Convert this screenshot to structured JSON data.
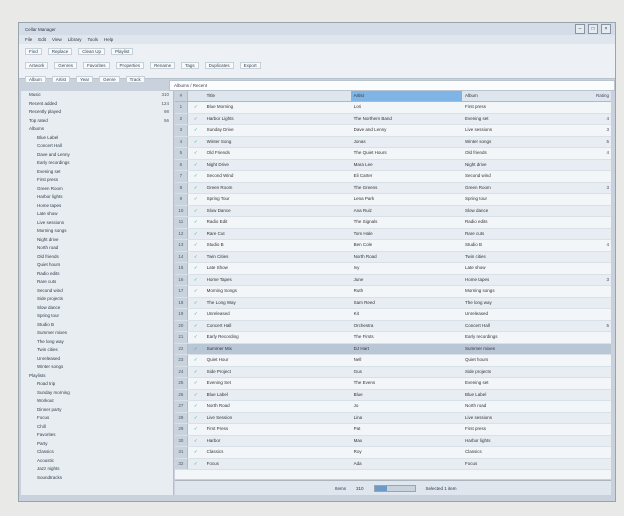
{
  "window": {
    "title": "Cellar Manager"
  },
  "menu": [
    "File",
    "Edit",
    "View",
    "Library",
    "Tools",
    "Help"
  ],
  "ribbon": {
    "row1": [
      "Find",
      "Replace",
      "Clean Up",
      "Playlist"
    ],
    "row2": [
      "Artwork",
      "Genres",
      "Favorites",
      "Properties",
      "Rename",
      "Tags",
      "Duplicates",
      "Export"
    ],
    "row3": [
      "Album",
      "Artist",
      "Year",
      "Genre",
      "Track"
    ]
  },
  "address": "Albums / Recent",
  "tree": [
    {
      "label": "Music",
      "count": "310"
    },
    {
      "label": "Recent added",
      "count": "124"
    },
    {
      "label": "Recently played",
      "count": "98"
    },
    {
      "label": "Top rated",
      "count": "56"
    },
    {
      "label": "Albums",
      "count": ""
    },
    {
      "label": "Blue Label",
      "count": ""
    },
    {
      "label": "Concert Hall",
      "count": ""
    },
    {
      "label": "Dave and Lenny",
      "count": ""
    },
    {
      "label": "Early recordings",
      "count": ""
    },
    {
      "label": "Evening set",
      "count": ""
    },
    {
      "label": "First press",
      "count": ""
    },
    {
      "label": "Green Room",
      "count": ""
    },
    {
      "label": "Harbor lights",
      "count": ""
    },
    {
      "label": "Home tapes",
      "count": ""
    },
    {
      "label": "Late show",
      "count": ""
    },
    {
      "label": "Live sessions",
      "count": ""
    },
    {
      "label": "Morning songs",
      "count": ""
    },
    {
      "label": "Night drive",
      "count": ""
    },
    {
      "label": "North road",
      "count": ""
    },
    {
      "label": "Old friends",
      "count": ""
    },
    {
      "label": "Quiet hours",
      "count": ""
    },
    {
      "label": "Radio edits",
      "count": ""
    },
    {
      "label": "Rare cuts",
      "count": ""
    },
    {
      "label": "Second wind",
      "count": ""
    },
    {
      "label": "Side projects",
      "count": ""
    },
    {
      "label": "Slow dance",
      "count": ""
    },
    {
      "label": "Spring tour",
      "count": ""
    },
    {
      "label": "Studio B",
      "count": ""
    },
    {
      "label": "Summer mixes",
      "count": ""
    },
    {
      "label": "The long way",
      "count": ""
    },
    {
      "label": "Twin cities",
      "count": ""
    },
    {
      "label": "Unreleased",
      "count": ""
    },
    {
      "label": "Winter songs",
      "count": ""
    },
    {
      "label": "Playlists",
      "count": ""
    },
    {
      "label": "Road trip",
      "count": ""
    },
    {
      "label": "Sunday morning",
      "count": ""
    },
    {
      "label": "Workout",
      "count": ""
    },
    {
      "label": "Dinner party",
      "count": ""
    },
    {
      "label": "Focus",
      "count": ""
    },
    {
      "label": "Chill",
      "count": ""
    },
    {
      "label": "Favorites",
      "count": ""
    },
    {
      "label": "Party",
      "count": ""
    },
    {
      "label": "Classics",
      "count": ""
    },
    {
      "label": "Acoustic",
      "count": ""
    },
    {
      "label": "Jazz nights",
      "count": ""
    },
    {
      "label": "Soundtracks",
      "count": ""
    }
  ],
  "columns": {
    "num": "#",
    "title": "Title",
    "artist": "Artist",
    "album": "Album",
    "rating": "Rating"
  },
  "rows": [
    {
      "n": "1",
      "title": "Blue Morning",
      "artist": "Lori",
      "album": "First press",
      "rating": ""
    },
    {
      "n": "2",
      "title": "Harbor Lights",
      "artist": "The Northern Band",
      "album": "Evening set",
      "rating": "4"
    },
    {
      "n": "3",
      "title": "Sunday Drive",
      "artist": "Dave and Lenny",
      "album": "Live sessions",
      "rating": "3"
    },
    {
      "n": "4",
      "title": "Winter Song",
      "artist": "Jonas",
      "album": "Winter songs",
      "rating": "5"
    },
    {
      "n": "5",
      "title": "Old Friends",
      "artist": "The Quiet Hours",
      "album": "Old friends",
      "rating": "4"
    },
    {
      "n": "6",
      "title": "Night Drive",
      "artist": "Mara Lee",
      "album": "Night drive",
      "rating": ""
    },
    {
      "n": "7",
      "title": "Second Wind",
      "artist": "Eli Carter",
      "album": "Second wind",
      "rating": ""
    },
    {
      "n": "8",
      "title": "Green Room",
      "artist": "The Greens",
      "album": "Green Room",
      "rating": "3"
    },
    {
      "n": "9",
      "title": "Spring Tour",
      "artist": "Lena Park",
      "album": "Spring tour",
      "rating": ""
    },
    {
      "n": "10",
      "title": "Slow Dance",
      "artist": "Ana Ruiz",
      "album": "Slow dance",
      "rating": ""
    },
    {
      "n": "11",
      "title": "Radio Edit",
      "artist": "The Signals",
      "album": "Radio edits",
      "rating": ""
    },
    {
      "n": "12",
      "title": "Rare Cut",
      "artist": "Tom Hale",
      "album": "Rare cuts",
      "rating": ""
    },
    {
      "n": "13",
      "title": "Studio B",
      "artist": "Ben Cole",
      "album": "Studio B",
      "rating": "4"
    },
    {
      "n": "14",
      "title": "Twin Cities",
      "artist": "North Road",
      "album": "Twin cities",
      "rating": ""
    },
    {
      "n": "15",
      "title": "Late Show",
      "artist": "Ivy",
      "album": "Late show",
      "rating": ""
    },
    {
      "n": "16",
      "title": "Home Tapes",
      "artist": "June",
      "album": "Home tapes",
      "rating": "3"
    },
    {
      "n": "17",
      "title": "Morning Songs",
      "artist": "Ruth",
      "album": "Morning songs",
      "rating": ""
    },
    {
      "n": "18",
      "title": "The Long Way",
      "artist": "Sam Reed",
      "album": "The long way",
      "rating": ""
    },
    {
      "n": "19",
      "title": "Unreleased",
      "artist": "Kit",
      "album": "Unreleased",
      "rating": ""
    },
    {
      "n": "20",
      "title": "Concert Hall",
      "artist": "Orchestra",
      "album": "Concert Hall",
      "rating": "5"
    },
    {
      "n": "21",
      "title": "Early Recording",
      "artist": "The Firsts",
      "album": "Early recordings",
      "rating": ""
    },
    {
      "n": "22",
      "title": "Summer Mix",
      "artist": "DJ Hart",
      "album": "Summer mixes",
      "rating": ""
    },
    {
      "n": "23",
      "title": "Quiet Hour",
      "artist": "Nell",
      "album": "Quiet hours",
      "rating": ""
    },
    {
      "n": "24",
      "title": "Side Project",
      "artist": "Gus",
      "album": "Side projects",
      "rating": ""
    },
    {
      "n": "25",
      "title": "Evening Set",
      "artist": "The Evens",
      "album": "Evening set",
      "rating": ""
    },
    {
      "n": "26",
      "title": "Blue Label",
      "artist": "Blue",
      "album": "Blue Label",
      "rating": ""
    },
    {
      "n": "27",
      "title": "North Road",
      "artist": "Jo",
      "album": "North road",
      "rating": ""
    },
    {
      "n": "28",
      "title": "Live Session",
      "artist": "Lina",
      "album": "Live sessions",
      "rating": ""
    },
    {
      "n": "29",
      "title": "First Press",
      "artist": "Pat",
      "album": "First press",
      "rating": ""
    },
    {
      "n": "30",
      "title": "Harbor",
      "artist": "Max",
      "album": "Harbor lights",
      "rating": ""
    },
    {
      "n": "31",
      "title": "Classics",
      "artist": "Roy",
      "album": "Classics",
      "rating": ""
    },
    {
      "n": "32",
      "title": "Focus",
      "artist": "Ada",
      "album": "Focus",
      "rating": ""
    }
  ],
  "selected_row": 21,
  "status": {
    "label": "Items",
    "count": "310",
    "info": "Selected 1 item"
  }
}
